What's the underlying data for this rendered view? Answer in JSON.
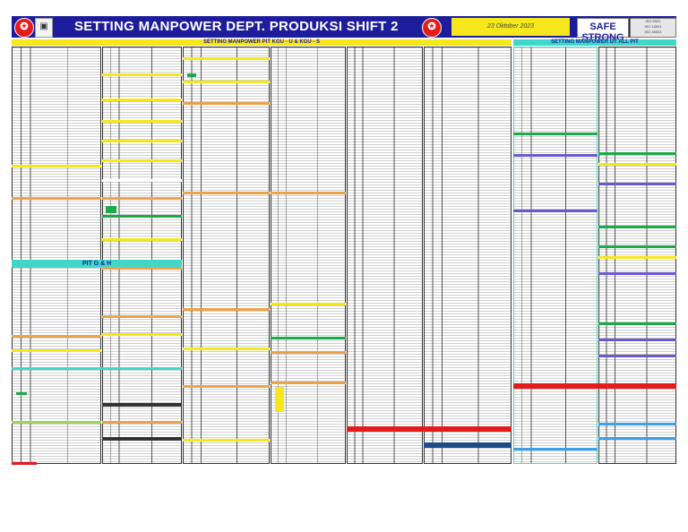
{
  "header": {
    "title": "SETTING MANPOWER DEPT. PRODUKSI SHIFT 2",
    "date": "23 Oktober 2023",
    "safe_logo": "SAFE STRONG",
    "left_logo_icon": "hse-badge-icon",
    "crest_icon": "company-crest-icon",
    "right_logo_icon": "hse-badge-icon",
    "iso_badges": [
      "ISO 9001",
      "ISO 14001",
      "ISO 45001"
    ]
  },
  "sections": {
    "pit_kgu": "SETTING MANPOWER PIT KGU - U & KGU - S",
    "dt_all_pit": "SETTING MANPOWER DT ALL PIT",
    "pit_g_h": "PIT G & H"
  },
  "colors": {
    "banner": "#1d1d9b",
    "yellow": "#f5e71c",
    "orange": "#e9a34a",
    "teal": "#3fd8c8",
    "green": "#1ea84a",
    "purple": "#6a5acd",
    "red": "#e31b1b",
    "blue": "#3aa0e8",
    "lime": "#9fd35a"
  }
}
